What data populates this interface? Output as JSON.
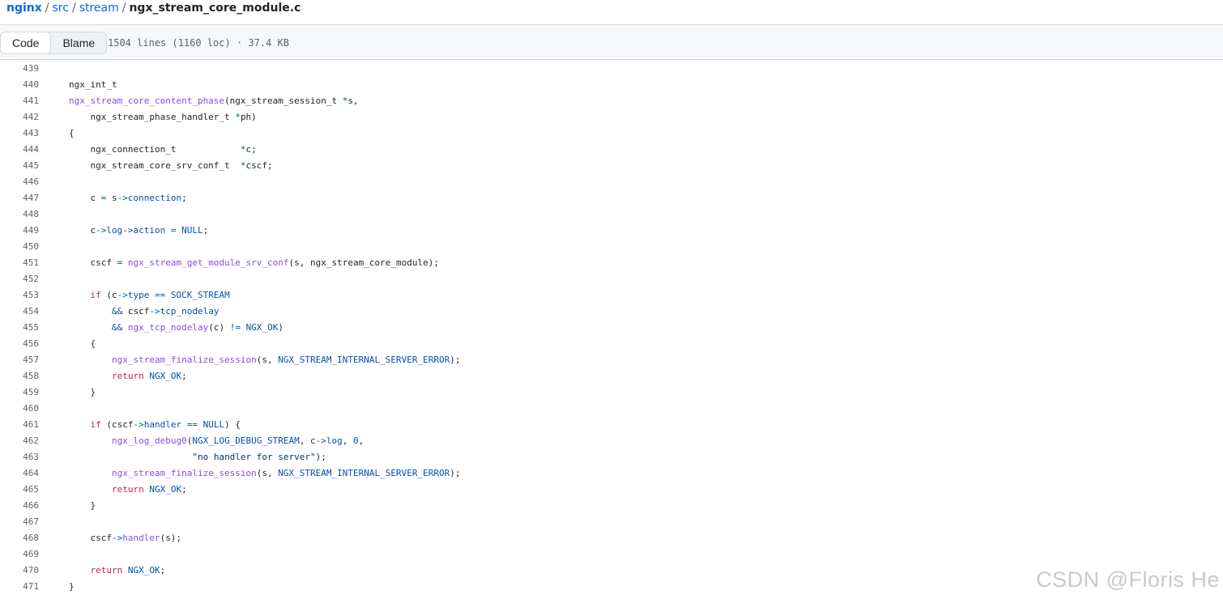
{
  "breadcrumb": {
    "repo": "nginx",
    "sep": "/",
    "dir1": "src",
    "dir2": "stream",
    "file": "ngx_stream_core_module.c"
  },
  "toolbar": {
    "code_tab": "Code",
    "blame_tab": "Blame",
    "file_info": "1504 lines (1160 loc) · 37.4 KB"
  },
  "colors": {
    "keyword": "#cf222e",
    "function": "#8250df",
    "constant": "#0550ae",
    "string": "#0a3069",
    "link": "#0969da"
  },
  "code": {
    "lines": [
      {
        "n": "439",
        "tokens": []
      },
      {
        "n": "440",
        "tokens": [
          {
            "t": "ngx_int_t"
          }
        ]
      },
      {
        "n": "441",
        "tokens": [
          {
            "t": "ngx_stream_core_content_phase",
            "c": "f"
          },
          {
            "t": "(ngx_stream_session_t "
          },
          {
            "t": "*",
            "c": "c"
          },
          {
            "t": "s,"
          }
        ]
      },
      {
        "n": "442",
        "tokens": [
          {
            "t": "    ngx_stream_phase_handler_t "
          },
          {
            "t": "*",
            "c": "c"
          },
          {
            "t": "ph)"
          }
        ]
      },
      {
        "n": "443",
        "tokens": [
          {
            "t": "{"
          }
        ]
      },
      {
        "n": "444",
        "tokens": [
          {
            "t": "    ngx_connection_t            "
          },
          {
            "t": "*",
            "c": "c"
          },
          {
            "t": "c;"
          }
        ]
      },
      {
        "n": "445",
        "tokens": [
          {
            "t": "    ngx_stream_core_srv_conf_t  "
          },
          {
            "t": "*",
            "c": "c"
          },
          {
            "t": "cscf;"
          }
        ]
      },
      {
        "n": "446",
        "tokens": []
      },
      {
        "n": "447",
        "tokens": [
          {
            "t": "    c "
          },
          {
            "t": "=",
            "c": "c"
          },
          {
            "t": " s"
          },
          {
            "t": "->",
            "c": "c"
          },
          {
            "t": "connection",
            "c": "c"
          },
          {
            "t": ";"
          }
        ]
      },
      {
        "n": "448",
        "tokens": []
      },
      {
        "n": "449",
        "tokens": [
          {
            "t": "    c"
          },
          {
            "t": "->",
            "c": "c"
          },
          {
            "t": "log",
            "c": "c"
          },
          {
            "t": "->",
            "c": "c"
          },
          {
            "t": "action",
            "c": "c"
          },
          {
            "t": " "
          },
          {
            "t": "=",
            "c": "c"
          },
          {
            "t": " "
          },
          {
            "t": "NULL",
            "c": "c"
          },
          {
            "t": ";"
          }
        ]
      },
      {
        "n": "450",
        "tokens": []
      },
      {
        "n": "451",
        "tokens": [
          {
            "t": "    cscf "
          },
          {
            "t": "=",
            "c": "c"
          },
          {
            "t": " "
          },
          {
            "t": "ngx_stream_get_module_srv_conf",
            "c": "f"
          },
          {
            "t": "(s, ngx_stream_core_module);"
          }
        ]
      },
      {
        "n": "452",
        "tokens": []
      },
      {
        "n": "453",
        "tokens": [
          {
            "t": "    "
          },
          {
            "t": "if",
            "c": "k"
          },
          {
            "t": " (c"
          },
          {
            "t": "->",
            "c": "c"
          },
          {
            "t": "type",
            "c": "c"
          },
          {
            "t": " "
          },
          {
            "t": "==",
            "c": "c"
          },
          {
            "t": " "
          },
          {
            "t": "SOCK_STREAM",
            "c": "c"
          }
        ]
      },
      {
        "n": "454",
        "tokens": [
          {
            "t": "        "
          },
          {
            "t": "&&",
            "c": "c"
          },
          {
            "t": " cscf"
          },
          {
            "t": "->",
            "c": "c"
          },
          {
            "t": "tcp_nodelay",
            "c": "c"
          }
        ]
      },
      {
        "n": "455",
        "tokens": [
          {
            "t": "        "
          },
          {
            "t": "&&",
            "c": "c"
          },
          {
            "t": " "
          },
          {
            "t": "ngx_tcp_nodelay",
            "c": "f"
          },
          {
            "t": "(c) "
          },
          {
            "t": "!=",
            "c": "c"
          },
          {
            "t": " "
          },
          {
            "t": "NGX_OK",
            "c": "c"
          },
          {
            "t": ")"
          }
        ]
      },
      {
        "n": "456",
        "tokens": [
          {
            "t": "    {"
          }
        ]
      },
      {
        "n": "457",
        "tokens": [
          {
            "t": "        "
          },
          {
            "t": "ngx_stream_finalize_session",
            "c": "f"
          },
          {
            "t": "(s, "
          },
          {
            "t": "NGX_STREAM_INTERNAL_SERVER_ERROR",
            "c": "c"
          },
          {
            "t": ");"
          }
        ]
      },
      {
        "n": "458",
        "tokens": [
          {
            "t": "        "
          },
          {
            "t": "return",
            "c": "k"
          },
          {
            "t": " "
          },
          {
            "t": "NGX_OK",
            "c": "c"
          },
          {
            "t": ";"
          }
        ]
      },
      {
        "n": "459",
        "tokens": [
          {
            "t": "    }"
          }
        ]
      },
      {
        "n": "460",
        "tokens": []
      },
      {
        "n": "461",
        "tokens": [
          {
            "t": "    "
          },
          {
            "t": "if",
            "c": "k"
          },
          {
            "t": " (cscf"
          },
          {
            "t": "->",
            "c": "c"
          },
          {
            "t": "handler",
            "c": "c"
          },
          {
            "t": " "
          },
          {
            "t": "==",
            "c": "c"
          },
          {
            "t": " "
          },
          {
            "t": "NULL",
            "c": "c"
          },
          {
            "t": ") {"
          }
        ]
      },
      {
        "n": "462",
        "tokens": [
          {
            "t": "        "
          },
          {
            "t": "ngx_log_debug0",
            "c": "f"
          },
          {
            "t": "("
          },
          {
            "t": "NGX_LOG_DEBUG_STREAM",
            "c": "c"
          },
          {
            "t": ", c"
          },
          {
            "t": "->",
            "c": "c"
          },
          {
            "t": "log",
            "c": "c"
          },
          {
            "t": ", "
          },
          {
            "t": "0",
            "c": "c"
          },
          {
            "t": ","
          }
        ]
      },
      {
        "n": "463",
        "tokens": [
          {
            "t": "                       "
          },
          {
            "t": "\"no handler for server\"",
            "c": "s"
          },
          {
            "t": ");"
          }
        ]
      },
      {
        "n": "464",
        "tokens": [
          {
            "t": "        "
          },
          {
            "t": "ngx_stream_finalize_session",
            "c": "f"
          },
          {
            "t": "(s, "
          },
          {
            "t": "NGX_STREAM_INTERNAL_SERVER_ERROR",
            "c": "c"
          },
          {
            "t": ");"
          }
        ]
      },
      {
        "n": "465",
        "tokens": [
          {
            "t": "        "
          },
          {
            "t": "return",
            "c": "k"
          },
          {
            "t": " "
          },
          {
            "t": "NGX_OK",
            "c": "c"
          },
          {
            "t": ";"
          }
        ]
      },
      {
        "n": "466",
        "tokens": [
          {
            "t": "    }"
          }
        ]
      },
      {
        "n": "467",
        "tokens": []
      },
      {
        "n": "468",
        "tokens": [
          {
            "t": "    cscf"
          },
          {
            "t": "->",
            "c": "c"
          },
          {
            "t": "handler",
            "c": "f"
          },
          {
            "t": "(s);"
          }
        ]
      },
      {
        "n": "469",
        "tokens": []
      },
      {
        "n": "470",
        "tokens": [
          {
            "t": "    "
          },
          {
            "t": "return",
            "c": "k"
          },
          {
            "t": " "
          },
          {
            "t": "NGX_OK",
            "c": "c"
          },
          {
            "t": ";"
          }
        ]
      },
      {
        "n": "471",
        "tokens": [
          {
            "t": "}"
          }
        ]
      }
    ]
  },
  "watermark": "CSDN @Floris He"
}
